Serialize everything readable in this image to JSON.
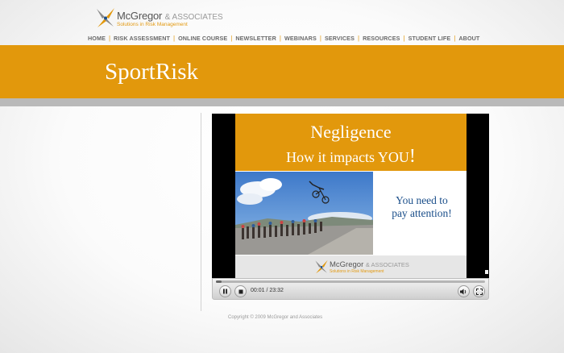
{
  "header": {
    "logo_name": "McGregor",
    "logo_associates": "& ASSOCIATES",
    "logo_tagline": "Solutions in Risk Management"
  },
  "nav": {
    "items": [
      "HOME",
      "RISK ASSESSMENT",
      "ONLINE COURSE",
      "NEWSLETTER",
      "WEBINARS",
      "SERVICES",
      "RESOURCES",
      "STUDENT LIFE",
      "ABOUT"
    ]
  },
  "banner": {
    "title": "SportRisk"
  },
  "video": {
    "slide_title": "Negligence",
    "slide_subtitle_prefix": "How it impacts YOU",
    "slide_subtitle_bang": "!",
    "slide_text_line1": "You need to",
    "slide_text_line2": "pay attention!",
    "slide_logo_name": "McGregor",
    "slide_logo_associates": "& ASSOCIATES",
    "slide_logo_tagline": "Solutions in Risk Management",
    "time_current": "00:01",
    "time_separator": " / ",
    "time_total": "23:32",
    "progress_fraction": 0.01
  },
  "footer": {
    "copyright": "Copyright © 2009 McGregor and Associates"
  },
  "colors": {
    "accent": "#e2980c",
    "slide_text": "#1a4e8a",
    "stripe": "#b9b9b9"
  }
}
